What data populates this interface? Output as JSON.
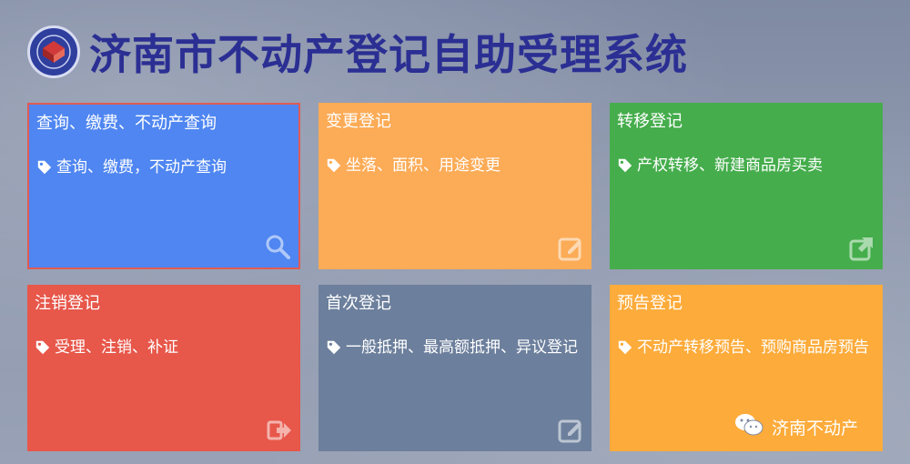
{
  "header": {
    "title": "济南市不动产登记自助受理系统"
  },
  "tiles": [
    {
      "title": "查询、缴费、不动产查询",
      "desc": "查询、缴费，不动产查询",
      "icon": "search-icon",
      "color": "#4f86f1"
    },
    {
      "title": "变更登记",
      "desc": "坐落、面积、用途变更",
      "icon": "edit-icon",
      "color": "#fcab56"
    },
    {
      "title": "转移登记",
      "desc": "产权转移、新建商品房买卖",
      "icon": "external-link-icon",
      "color": "#45ad4c"
    },
    {
      "title": "注销登记",
      "desc": "受理、注销、补证",
      "icon": "sign-out-icon",
      "color": "#e7574a"
    },
    {
      "title": "首次登记",
      "desc": "一般抵押、最高额抵押、异议登记",
      "icon": "edit-icon",
      "color": "#6c7f9c"
    },
    {
      "title": "预告登记",
      "desc": "不动产转移预告、预购商品房预告",
      "icon": "tag-icon",
      "color": "#fdab3a"
    }
  ],
  "watermark": {
    "text": "济南不动产",
    "icon": "wechat-icon"
  }
}
